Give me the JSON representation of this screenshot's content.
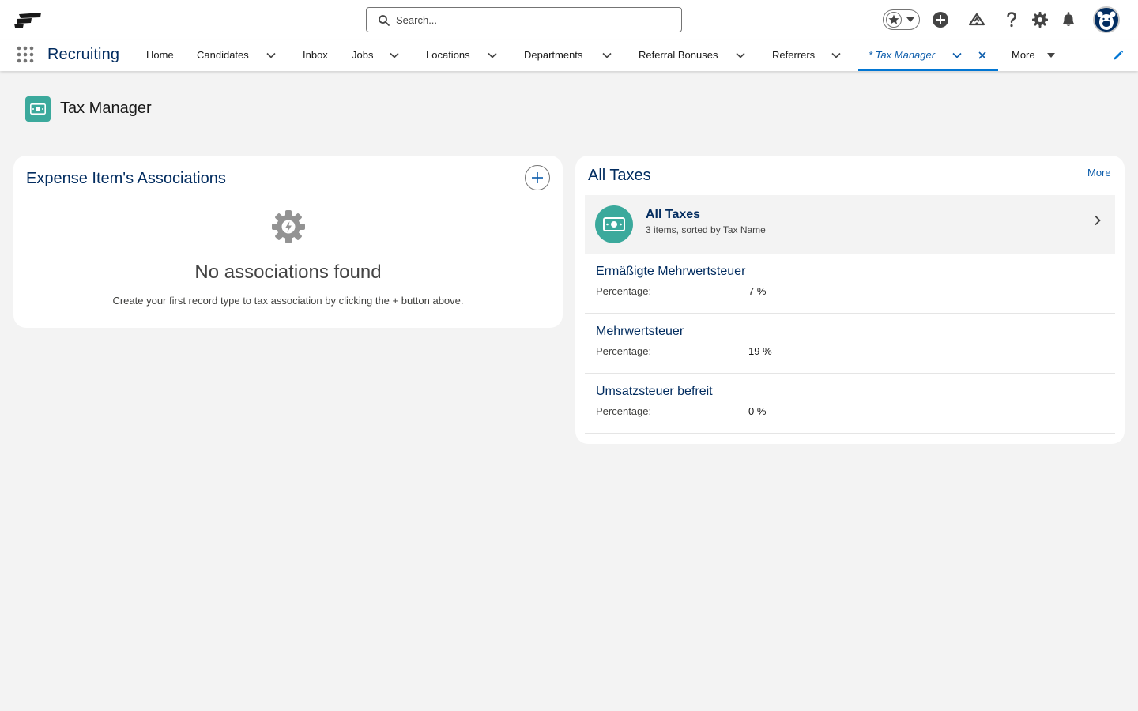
{
  "header": {
    "search_placeholder": "Search..."
  },
  "nav": {
    "app_name": "Recruiting",
    "items": [
      {
        "label": "Home"
      },
      {
        "label": "Candidates"
      },
      {
        "label": "Inbox"
      },
      {
        "label": "Jobs"
      },
      {
        "label": "Locations"
      },
      {
        "label": "Departments"
      },
      {
        "label": "Referral Bonuses"
      },
      {
        "label": "Referrers"
      },
      {
        "label": "* Tax Manager"
      },
      {
        "label": "More"
      }
    ]
  },
  "page": {
    "title": "Tax Manager"
  },
  "associations": {
    "title": "Expense Item's Associations",
    "empty_title": "No associations found",
    "empty_text": "Create your first record type to tax association by clicking the + button above."
  },
  "taxes": {
    "title": "All Taxes",
    "more_label": "More",
    "list_title": "All Taxes",
    "list_subtitle": "3 items, sorted by Tax Name",
    "rows": [
      {
        "name": "Ermäßigte Mehrwertsteuer",
        "label": "Percentage:",
        "value": "7 %"
      },
      {
        "name": "Mehrwertsteuer",
        "label": "Percentage:",
        "value": "19 %"
      },
      {
        "name": "Umsatzsteuer befreit",
        "label": "Percentage:",
        "value": "0 %"
      }
    ]
  },
  "colors": {
    "accent": "#0176d3",
    "brand_navy": "#032d60",
    "tax_icon": "#3ba99c"
  }
}
